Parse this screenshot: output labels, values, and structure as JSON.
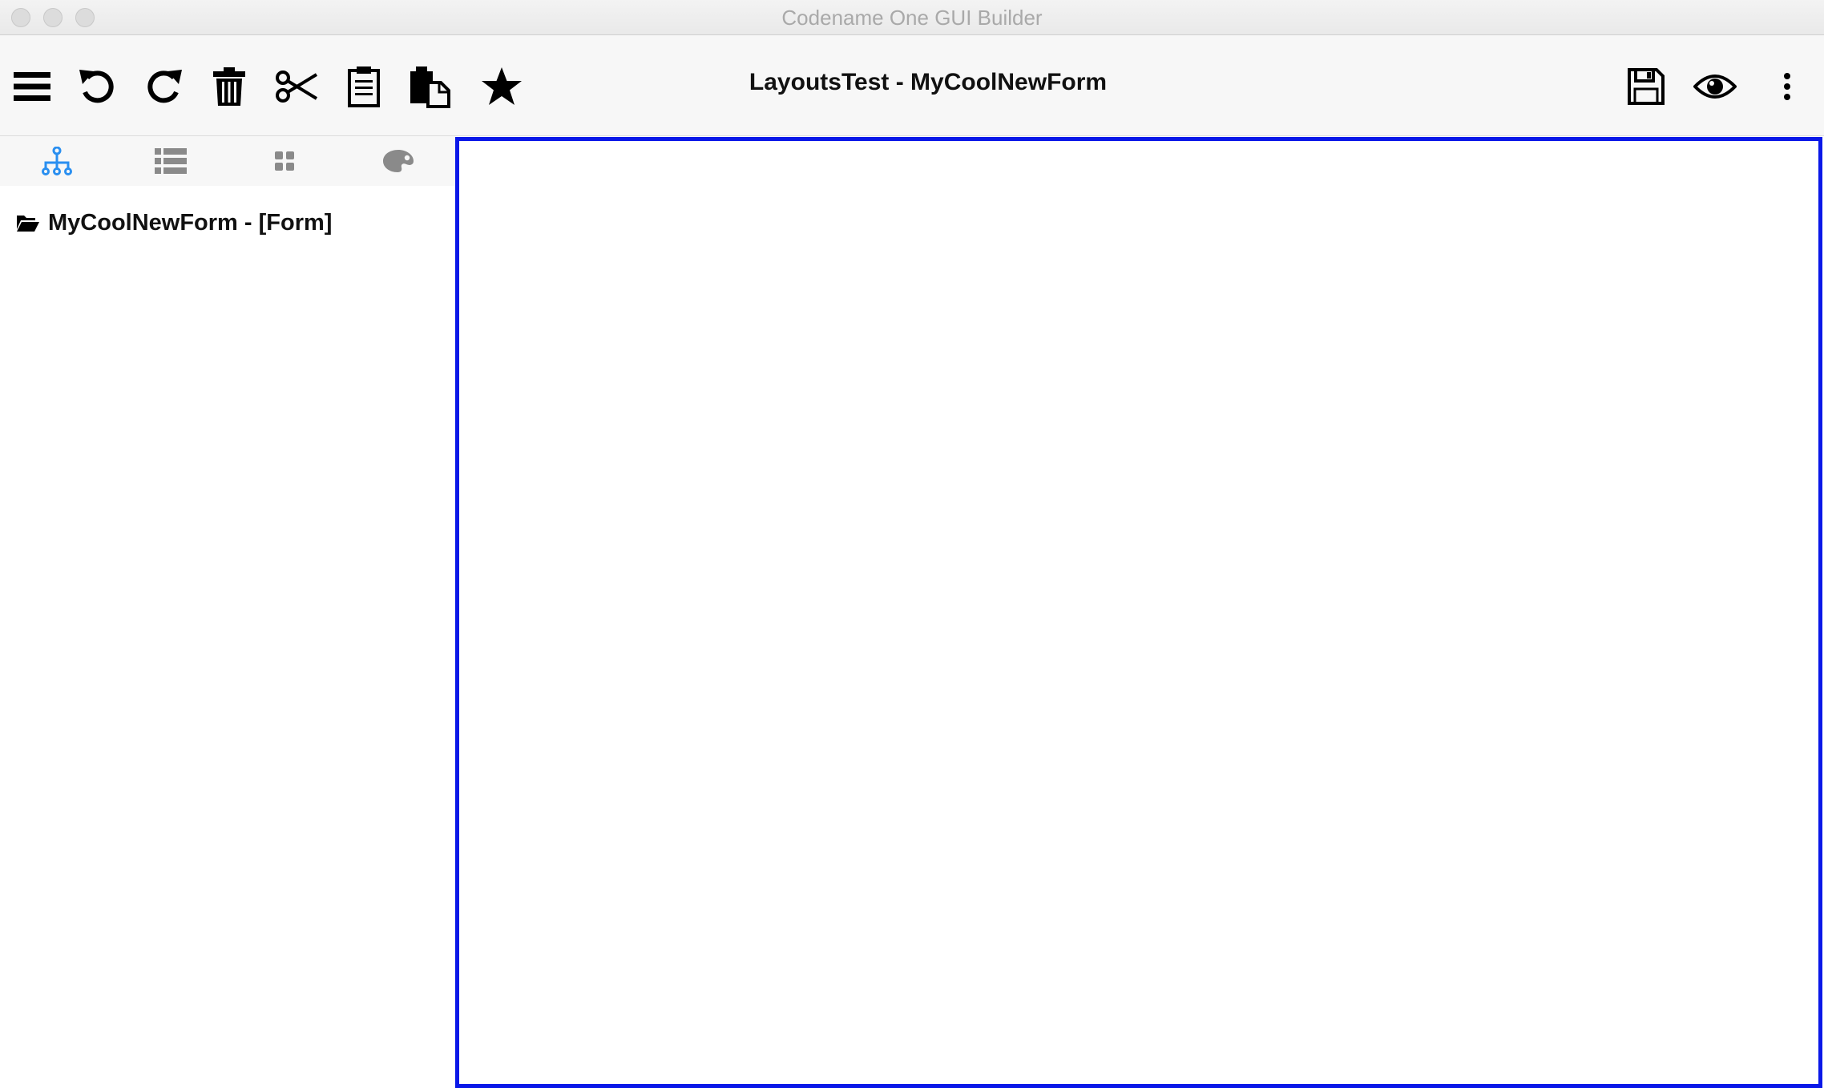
{
  "window": {
    "title": "Codename One GUI Builder"
  },
  "toolbar": {
    "form_title": "LayoutsTest - MyCoolNewForm",
    "buttons": [
      {
        "name": "menu",
        "icon": "hamburger-menu-icon"
      },
      {
        "name": "undo",
        "icon": "undo-icon"
      },
      {
        "name": "redo",
        "icon": "redo-icon"
      },
      {
        "name": "delete",
        "icon": "trash-icon"
      },
      {
        "name": "cut",
        "icon": "scissors-icon"
      },
      {
        "name": "copy",
        "icon": "clipboard-icon"
      },
      {
        "name": "paste",
        "icon": "paste-icon"
      },
      {
        "name": "favorite",
        "icon": "star-icon"
      },
      {
        "name": "save",
        "icon": "floppy-disk-icon"
      },
      {
        "name": "preview",
        "icon": "eye-icon"
      },
      {
        "name": "more",
        "icon": "vertical-ellipsis-icon"
      }
    ]
  },
  "left_panel": {
    "tabs": [
      {
        "name": "hierarchy",
        "icon": "component-tree-icon",
        "active": true
      },
      {
        "name": "properties",
        "icon": "list-icon",
        "active": false
      },
      {
        "name": "components",
        "icon": "grid-icon",
        "active": false
      },
      {
        "name": "theme",
        "icon": "palette-icon",
        "active": false
      }
    ],
    "tree": {
      "root_label": "MyCoolNewForm - [Form]",
      "root_icon": "open-folder-icon"
    }
  },
  "colors": {
    "active_tab": "#2a8ff0",
    "inactive_tab": "#8a8a8a",
    "canvas_border": "#0a18e8"
  }
}
